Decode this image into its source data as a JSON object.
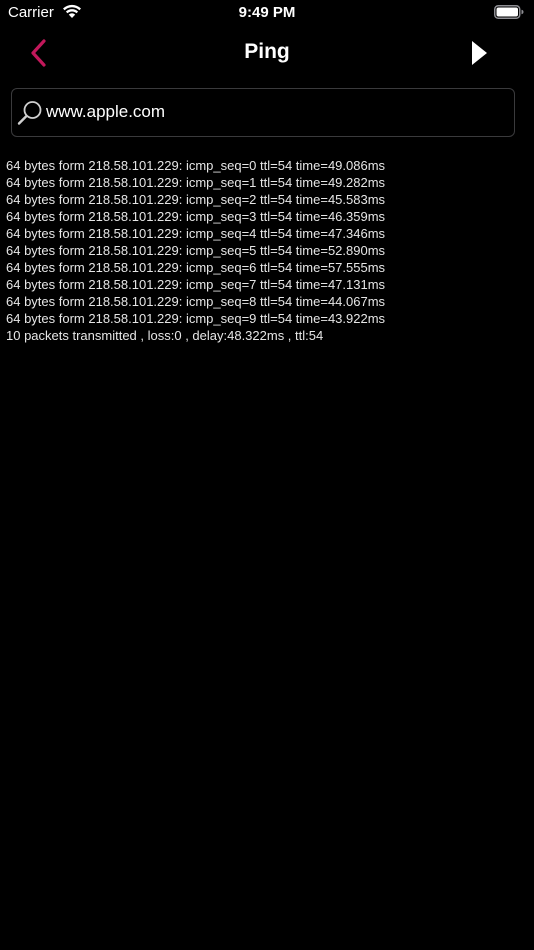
{
  "status_bar": {
    "carrier": "Carrier",
    "time": "9:49 PM"
  },
  "nav": {
    "title": "Ping",
    "back_icon": "chevron-left-icon",
    "run_icon": "play-icon",
    "accent_color": "#c2185b"
  },
  "search": {
    "value": "www.apple.com",
    "icon": "search-icon"
  },
  "output": {
    "lines": [
      "64 bytes form 218.58.101.229: icmp_seq=0 ttl=54 time=49.086ms",
      "64 bytes form 218.58.101.229: icmp_seq=1 ttl=54 time=49.282ms",
      "64 bytes form 218.58.101.229: icmp_seq=2 ttl=54 time=45.583ms",
      "64 bytes form 218.58.101.229: icmp_seq=3 ttl=54 time=46.359ms",
      "64 bytes form 218.58.101.229: icmp_seq=4 ttl=54 time=47.346ms",
      "64 bytes form 218.58.101.229: icmp_seq=5 ttl=54 time=52.890ms",
      "64 bytes form 218.58.101.229: icmp_seq=6 ttl=54 time=57.555ms",
      "64 bytes form 218.58.101.229: icmp_seq=7 ttl=54 time=47.131ms",
      "64 bytes form 218.58.101.229: icmp_seq=8 ttl=54 time=44.067ms",
      "64 bytes form 218.58.101.229: icmp_seq=9 ttl=54 time=43.922ms",
      "10 packets transmitted , loss:0 , delay:48.322ms , ttl:54"
    ]
  }
}
